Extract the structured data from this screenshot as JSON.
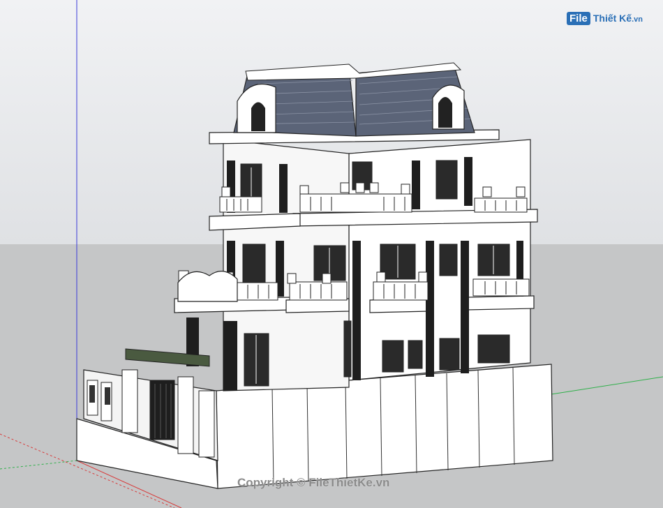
{
  "watermark": {
    "brand_prefix": "File",
    "brand_suffix": "Thiết Kế",
    "brand_domain": ".vn",
    "copyright": "Copyright © FileThietKe.vn"
  },
  "colors": {
    "roof": "#5b6478",
    "axis_blue": "#3a3ad8",
    "axis_red": "#d83a3a",
    "axis_green": "#2fb04a",
    "ground": "#c5c6c7"
  },
  "icons": [
    "file-logo-icon"
  ]
}
